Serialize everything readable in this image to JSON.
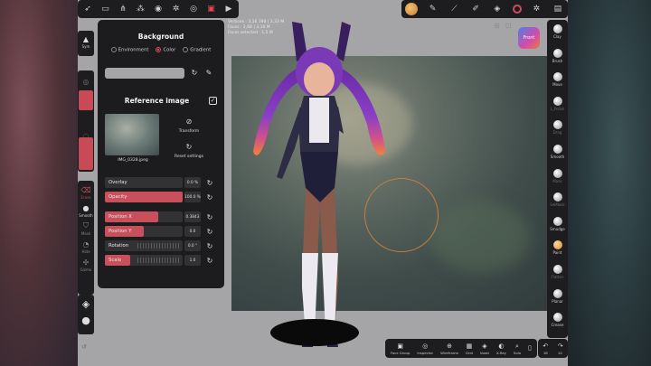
{
  "stats": {
    "lines": [
      "Vertices : 3,16 398 | 3,33 M",
      "Faces : 2,68 | 3,16 M",
      "Faces selected : 1,5 M"
    ]
  },
  "view_cube": {
    "label": "Front"
  },
  "top_left_icons": [
    "nomad-logo",
    "folder-icon",
    "share-icon",
    "scene-icon",
    "material-icon",
    "settings-icon",
    "camera-icon",
    "background-icon",
    "video-icon"
  ],
  "top_right_icons": [
    "avatar",
    "pen-icon",
    "brush-icon",
    "paint-icon",
    "layers-icon",
    "color-icon",
    "settings-icon",
    "more-icon"
  ],
  "left_column": {
    "sym_label": "Sym",
    "tool_labels": [
      "Erase",
      "Smooth",
      "Mask",
      "Hide",
      "Gizmo"
    ]
  },
  "panel": {
    "title": "Background",
    "options": [
      "Environment",
      "Color",
      "Gradient"
    ],
    "selected_option": "Color",
    "reference_title": "Reference image",
    "thumbnail_name": "IMG_0328.jpeg",
    "transform_label": "Transform",
    "reset_label": "Reset settings",
    "sliders": [
      {
        "label": "Overlay",
        "value": "0.0 %",
        "fill": 0.0
      },
      {
        "label": "Opacity",
        "value": "100.0 %",
        "fill": 1.0
      },
      {
        "label": "Position X",
        "value": "0.3843",
        "fill": 0.69
      },
      {
        "label": "Position Y",
        "value": "0.0",
        "fill": 0.5
      },
      {
        "label": "Rotation",
        "value": "0.0 °",
        "fill": 0.0
      },
      {
        "label": "Scale",
        "value": "1.0",
        "fill": 0.33
      }
    ]
  },
  "right_column": [
    {
      "label": "Clay",
      "dim": false,
      "active": false
    },
    {
      "label": "Brush",
      "dim": false,
      "active": false
    },
    {
      "label": "Move",
      "dim": false,
      "active": false
    },
    {
      "label": "L_Polish",
      "dim": true,
      "active": false
    },
    {
      "label": "Drag",
      "dim": true,
      "active": false
    },
    {
      "label": "Smooth",
      "dim": false,
      "active": false
    },
    {
      "label": "Mask",
      "dim": true,
      "active": false
    },
    {
      "label": "SelMask",
      "dim": true,
      "active": false
    },
    {
      "label": "Smudge",
      "dim": false,
      "active": false
    },
    {
      "label": "Paint",
      "dim": false,
      "active": true
    },
    {
      "label": "Flatten",
      "dim": true,
      "active": false
    },
    {
      "label": "Planar",
      "dim": false,
      "active": false
    },
    {
      "label": "Crease",
      "dim": false,
      "active": false
    }
  ],
  "bottom_toolbar": [
    {
      "label": "Face Group",
      "icon": "▣"
    },
    {
      "label": "Inspector",
      "icon": "◎"
    },
    {
      "label": "Wireframe",
      "icon": "⊕"
    },
    {
      "label": "Grid",
      "icon": "▦"
    },
    {
      "label": "Voxel",
      "icon": "◈"
    },
    {
      "label": "X-Ray",
      "icon": "◐"
    },
    {
      "label": "Solo",
      "icon": "⌕"
    },
    {
      "label": "",
      "icon": "▯"
    }
  ],
  "undo_toolbar": [
    {
      "label": "18",
      "icon": "↶"
    },
    {
      "label": "41",
      "icon": "↷"
    }
  ],
  "colors": {
    "accent": "#c8505c",
    "panel": "#1c1c1e",
    "viewport": "#a5a5a7"
  }
}
